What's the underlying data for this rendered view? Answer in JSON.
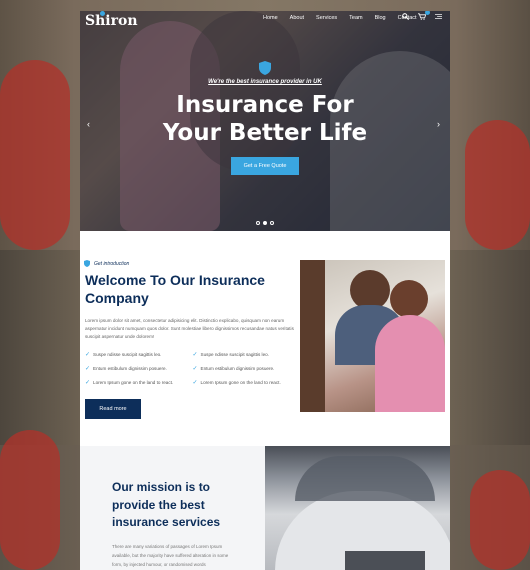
{
  "nav": {
    "logo": "Shiron",
    "menu": [
      "Home",
      "About",
      "Services",
      "Team",
      "Blog",
      "Contact"
    ]
  },
  "hero": {
    "tagline": "We're the best insurance provider in UK",
    "title_line1": "Insurance For",
    "title_line2": "Your Better Life",
    "cta": "Get a Free Quote",
    "slides": 3,
    "active_slide": 2
  },
  "welcome": {
    "label": "Get introduction",
    "title": "Welcome To Our Insurance Company",
    "text": "Lorem ipsum dolor sit amet, consectetur adipisicing elit. Distinctio explicabo, quisquam non earum aspernatur incidunt numquam quos dolor. Sunt molestiae libero dignissimos recusandae natus veritatis suscipit aspernatur unde dolorem!",
    "checks": [
      "Suspe ndisse suscipit sagittis leo.",
      "Suspe ndisse suscipit sagittis leo.",
      "Entum estibulum dignissim posuere.",
      "Entum estibulum dignissim posuere.",
      "Lorem Ipsum gone on the land to react.",
      "Lorem Ipsum gone on the land to react."
    ],
    "button": "Read more"
  },
  "mission": {
    "title": "Our mission is to provide the best insurance services",
    "text": "There are many variations of passages of Lorem Ipsum available, but the majority have suffered alteration in some form, by injected humour, or randomised words"
  },
  "colors": {
    "navy": "#0d2e5a",
    "accent": "#3aa6e0"
  }
}
